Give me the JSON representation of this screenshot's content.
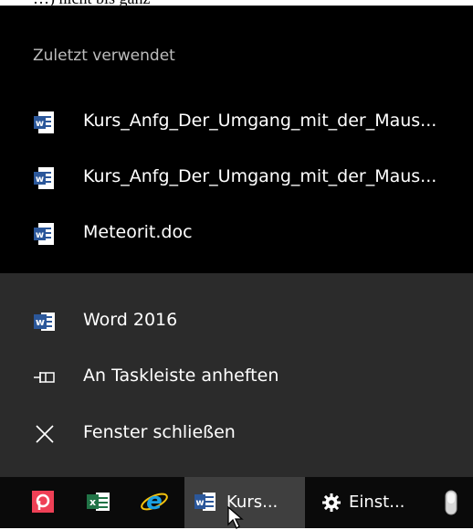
{
  "top_fragment": "…) nicht bis ganz",
  "jumplist": {
    "section_header": "Zuletzt verwendet",
    "recent_items": [
      {
        "label": "Kurs_Anfg_Der_Umgang_mit_der_Maus...",
        "icon": "word-doc-icon"
      },
      {
        "label": "Kurs_Anfg_Der_Umgang_mit_der_Maus...",
        "icon": "word-doc-icon"
      },
      {
        "label": "Meteorit.doc",
        "icon": "word-doc-icon"
      }
    ],
    "tasks": [
      {
        "label": "Word 2016",
        "icon": "word-app-icon"
      },
      {
        "label": "An Taskleiste anheften",
        "icon": "pin-icon"
      },
      {
        "label": "Fenster schließen",
        "icon": "close-icon"
      }
    ]
  },
  "taskbar": {
    "items": [
      {
        "icon": "pocket-app-icon"
      },
      {
        "icon": "excel-icon"
      },
      {
        "icon": "internet-explorer-icon"
      },
      {
        "icon": "word-icon",
        "label": "Kurs...",
        "active": true
      },
      {
        "icon": "settings-icon",
        "label": "Einst..."
      },
      {
        "icon": "pill-app-icon"
      }
    ]
  },
  "colors": {
    "recent_bg": "#000000",
    "tasks_bg": "#2b2b2b",
    "taskbar_bg": "#0a0a0a",
    "word_blue": "#2b579a",
    "excel_green": "#217346",
    "ie_blue": "#1ba1e2",
    "pocket_red": "#ef4056"
  }
}
